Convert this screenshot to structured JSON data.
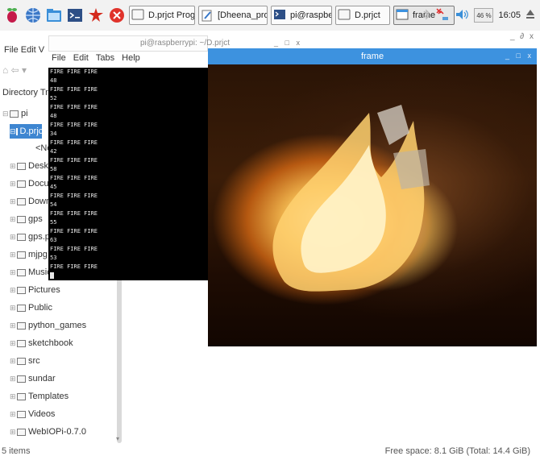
{
  "taskbar": {
    "tasks": [
      {
        "label": "D.prjct Programs"
      },
      {
        "label": "[Dheena_project -..."
      },
      {
        "label": "pi@raspberrypi: ..."
      },
      {
        "label": "D.prjct"
      },
      {
        "label": "frame"
      }
    ],
    "cpu_label": "46 %",
    "clock": "16:05"
  },
  "file_manager": {
    "menu": "File  Edit  V",
    "title_partial": "D.prjct",
    "directory_tree_label": "Directory Tre",
    "tree_items": [
      {
        "label": "pi"
      },
      {
        "label": "D.prjc"
      },
      {
        "label": "<No"
      },
      {
        "label": "Deskt"
      },
      {
        "label": "Docur"
      },
      {
        "label": "Down"
      },
      {
        "label": "gps"
      },
      {
        "label": "gps.p"
      },
      {
        "label": "mjpg"
      },
      {
        "label": "Music"
      },
      {
        "label": "Pictures"
      },
      {
        "label": "Public"
      },
      {
        "label": "python_games"
      },
      {
        "label": "sketchbook"
      },
      {
        "label": "src"
      },
      {
        "label": "sundar"
      },
      {
        "label": "Templates"
      },
      {
        "label": "Videos"
      },
      {
        "label": "WebIOPi-0.7.0"
      }
    ],
    "status_left": "5 items",
    "status_right": "Free space: 8.1 GiB (Total: 14.4 GiB)"
  },
  "terminal": {
    "title": "pi@raspberrypi: ~/D.prjct",
    "menu": [
      "File",
      "Edit",
      "Tabs",
      "Help"
    ],
    "lines": [
      "FIRE FIRE FIRE",
      "48",
      "FIRE FIRE FIRE",
      "52",
      "FIRE FIRE FIRE",
      "48",
      "FIRE FIRE FIRE",
      "34",
      "FIRE FIRE FIRE",
      "42",
      "FIRE FIRE FIRE",
      "58",
      "FIRE FIRE FIRE",
      "45",
      "FIRE FIRE FIRE",
      "54",
      "FIRE FIRE FIRE",
      "55",
      "FIRE FIRE FIRE",
      "63",
      "FIRE FIRE FIRE",
      "53",
      "FIRE FIRE FIRE"
    ]
  },
  "frame": {
    "title": "frame",
    "controls": "_ □ x"
  }
}
